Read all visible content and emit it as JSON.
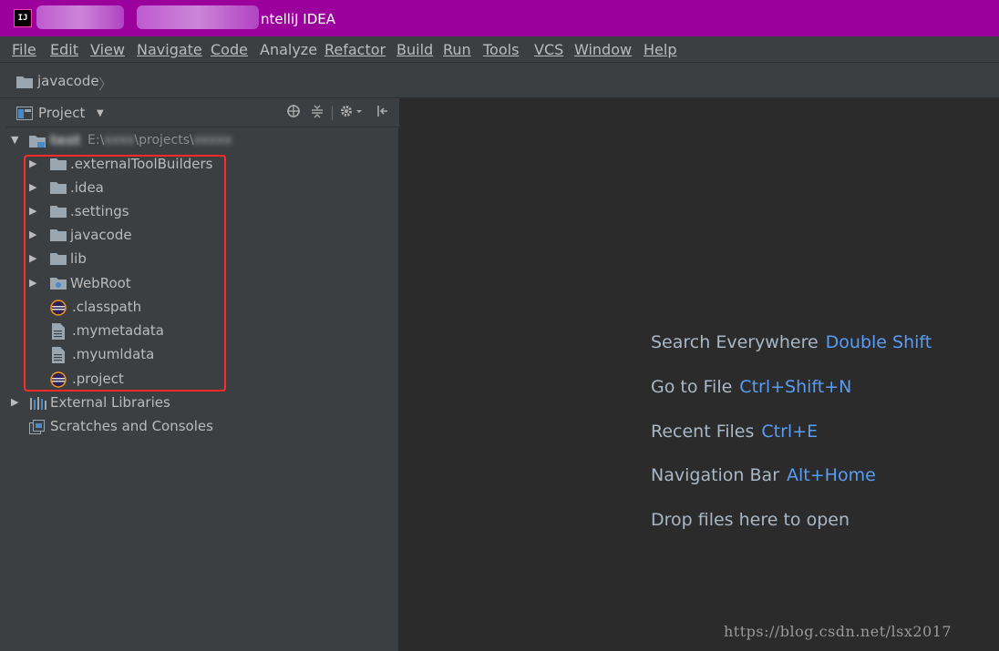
{
  "window": {
    "title": "ntelliJ IDEA",
    "app_icon_text": "IJ",
    "title_color": "#9c009c"
  },
  "menu": [
    {
      "label": "File",
      "mnemonic": true
    },
    {
      "label": "Edit",
      "mnemonic": true
    },
    {
      "label": "View",
      "mnemonic": true
    },
    {
      "label": "Navigate",
      "mnemonic": true
    },
    {
      "label": "Code",
      "mnemonic": true
    },
    {
      "label": "Analyze",
      "mnemonic": false
    },
    {
      "label": "Refactor",
      "mnemonic": true
    },
    {
      "label": "Build",
      "mnemonic": true
    },
    {
      "label": "Run",
      "mnemonic": true
    },
    {
      "label": "Tools",
      "mnemonic": true
    },
    {
      "label": "VCS",
      "mnemonic": true
    },
    {
      "label": "Window",
      "mnemonic": true
    },
    {
      "label": "Help",
      "mnemonic": true
    }
  ],
  "breadcrumb": {
    "label": "javacode",
    "separator": "〉"
  },
  "project_panel": {
    "header_label": "Project",
    "toolbar_icons": [
      "locate-icon",
      "collapse-all-icon",
      "gear-icon",
      "hide-panel-icon"
    ]
  },
  "tree": {
    "root": {
      "name": "test",
      "path": "E:\\",
      "path_tail": "\\projects\\"
    },
    "items": [
      {
        "label": ".externalToolBuilders",
        "type": "folder",
        "expandable": true
      },
      {
        "label": ".idea",
        "type": "folder",
        "expandable": true
      },
      {
        "label": ".settings",
        "type": "folder",
        "expandable": true
      },
      {
        "label": "javacode",
        "type": "folder",
        "expandable": true
      },
      {
        "label": "lib",
        "type": "folder",
        "expandable": true
      },
      {
        "label": "WebRoot",
        "type": "web-folder",
        "expandable": true
      },
      {
        "label": ".classpath",
        "type": "eclipse-file",
        "expandable": false
      },
      {
        "label": ".mymetadata",
        "type": "file",
        "expandable": false
      },
      {
        "label": ".myumldata",
        "type": "file",
        "expandable": false
      },
      {
        "label": ".project",
        "type": "eclipse-file",
        "expandable": false
      }
    ],
    "external_libraries": "External Libraries",
    "scratches": "Scratches and Consoles"
  },
  "editor_hints": [
    {
      "text": "Search Everywhere",
      "key": "Double Shift"
    },
    {
      "text": "Go to File",
      "key": "Ctrl+Shift+N"
    },
    {
      "text": "Recent Files",
      "key": "Ctrl+E"
    },
    {
      "text": "Navigation Bar",
      "key": "Alt+Home"
    },
    {
      "text": "Drop files here to open",
      "key": ""
    }
  ],
  "watermark": "https://blog.csdn.net/lsx2017",
  "colors": {
    "accent_key": "#589df6",
    "annotation_box": "#ff2a2a",
    "panel_bg": "#3c3f41",
    "editor_bg": "#2b2b2b"
  }
}
